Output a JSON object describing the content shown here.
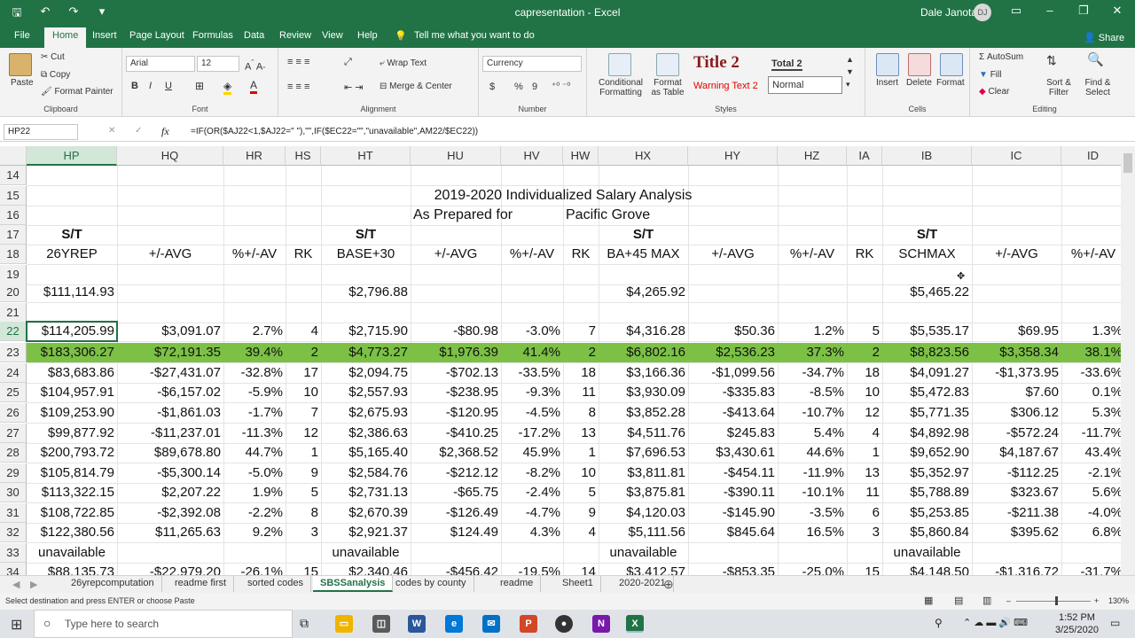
{
  "window": {
    "doc_title": "capresentation  -  Excel",
    "user": "Dale Janota",
    "user_initials": "DJ"
  },
  "qat": {
    "save": "🖫",
    "undo": "↶",
    "redo": "↷",
    "customize": "▾"
  },
  "tabs": [
    "File",
    "Home",
    "Insert",
    "Page Layout",
    "Formulas",
    "Data",
    "Review",
    "View",
    "Help"
  ],
  "tell_me": "Tell me what you want to do",
  "share": "Share",
  "ribbon": {
    "clipboard": {
      "paste": "Paste",
      "cut": "Cut",
      "copy": "Copy",
      "format_painter": "Format Painter",
      "label": "Clipboard"
    },
    "font": {
      "name": "Arial",
      "size": "12",
      "bold": "B",
      "italic": "I",
      "underline": "U",
      "label": "Font"
    },
    "alignment": {
      "wrap": "Wrap Text",
      "merge": "Merge & Center",
      "label": "Alignment"
    },
    "number": {
      "format": "Currency",
      "dollar": "$",
      "percent": "%",
      "comma": "9",
      "label": "Number"
    },
    "styles": {
      "conditional": "Conditional Formatting",
      "format_table": "Format as Table",
      "title2": "Title 2",
      "total2": "Total 2",
      "warning": "Warning Text 2",
      "normal": "Normal",
      "label": "Styles"
    },
    "cells": {
      "insert": "Insert",
      "delete": "Delete",
      "format": "Format",
      "label": "Cells"
    },
    "editing": {
      "autosum": "AutoSum",
      "fill": "Fill",
      "clear": "Clear",
      "sort": "Sort & Filter",
      "find": "Find & Select",
      "label": "Editing"
    }
  },
  "formula_bar": {
    "name_box": "HP22",
    "fx": "fx",
    "formula": "=IF(OR($AJ22<1,$AJ22=\" \"),\"\",IF($EC22=\"\",\"unavailable\",AM22/$EC22))"
  },
  "columns": [
    "HP",
    "HQ",
    "HR",
    "HS",
    "HT",
    "HU",
    "HV",
    "HW",
    "HX",
    "HY",
    "HZ",
    "IA",
    "IB",
    "IC",
    "ID"
  ],
  "row_numbers": [
    "14",
    "15",
    "16",
    "17",
    "18",
    "19",
    "20",
    "21",
    "22",
    "23",
    "24",
    "25",
    "26",
    "27",
    "28",
    "29",
    "30",
    "31",
    "32",
    "33",
    "34"
  ],
  "title_line1": "2019-2020 Individualized Salary  Analysis",
  "title_line2a": "As Prepared for",
  "title_line2b": "Pacific Grove",
  "st_label": "S/T",
  "headers": [
    "26YREP",
    "+/-AVG",
    "%+/-AV",
    "RK",
    "BASE+30",
    "+/-AVG",
    "%+/-AV",
    "RK",
    "BA+45 MAX",
    "+/-AVG",
    "%+/-AV",
    "RK",
    "SCHMAX",
    "+/-AVG",
    "%+/-AV"
  ],
  "row20": {
    "hp": "$111,114.93",
    "ht": "$2,796.88",
    "hx": "$4,265.92",
    "ib": "$5,465.22"
  },
  "rows": [
    [
      "$114,205.99",
      "$3,091.07",
      "2.7%",
      "4",
      "$2,715.90",
      "-$80.98",
      "-3.0%",
      "7",
      "$4,316.28",
      "$50.36",
      "1.2%",
      "5",
      "$5,535.17",
      "$69.95",
      "1.3%"
    ],
    [
      "$183,306.27",
      "$72,191.35",
      "39.4%",
      "2",
      "$4,773.27",
      "$1,976.39",
      "41.4%",
      "2",
      "$6,802.16",
      "$2,536.23",
      "37.3%",
      "2",
      "$8,823.56",
      "$3,358.34",
      "38.1%"
    ],
    [
      "$83,683.86",
      "-$27,431.07",
      "-32.8%",
      "17",
      "$2,094.75",
      "-$702.13",
      "-33.5%",
      "18",
      "$3,166.36",
      "-$1,099.56",
      "-34.7%",
      "18",
      "$4,091.27",
      "-$1,373.95",
      "-33.6%"
    ],
    [
      "$104,957.91",
      "-$6,157.02",
      "-5.9%",
      "10",
      "$2,557.93",
      "-$238.95",
      "-9.3%",
      "11",
      "$3,930.09",
      "-$335.83",
      "-8.5%",
      "10",
      "$5,472.83",
      "$7.60",
      "0.1%"
    ],
    [
      "$109,253.90",
      "-$1,861.03",
      "-1.7%",
      "7",
      "$2,675.93",
      "-$120.95",
      "-4.5%",
      "8",
      "$3,852.28",
      "-$413.64",
      "-10.7%",
      "12",
      "$5,771.35",
      "$306.12",
      "5.3%"
    ],
    [
      "$99,877.92",
      "-$11,237.01",
      "-11.3%",
      "12",
      "$2,386.63",
      "-$410.25",
      "-17.2%",
      "13",
      "$4,511.76",
      "$245.83",
      "5.4%",
      "4",
      "$4,892.98",
      "-$572.24",
      "-11.7%"
    ],
    [
      "$200,793.72",
      "$89,678.80",
      "44.7%",
      "1",
      "$5,165.40",
      "$2,368.52",
      "45.9%",
      "1",
      "$7,696.53",
      "$3,430.61",
      "44.6%",
      "1",
      "$9,652.90",
      "$4,187.67",
      "43.4%"
    ],
    [
      "$105,814.79",
      "-$5,300.14",
      "-5.0%",
      "9",
      "$2,584.76",
      "-$212.12",
      "-8.2%",
      "10",
      "$3,811.81",
      "-$454.11",
      "-11.9%",
      "13",
      "$5,352.97",
      "-$112.25",
      "-2.1%"
    ],
    [
      "$113,322.15",
      "$2,207.22",
      "1.9%",
      "5",
      "$2,731.13",
      "-$65.75",
      "-2.4%",
      "5",
      "$3,875.81",
      "-$390.11",
      "-10.1%",
      "11",
      "$5,788.89",
      "$323.67",
      "5.6%"
    ],
    [
      "$108,722.85",
      "-$2,392.08",
      "-2.2%",
      "8",
      "$2,670.39",
      "-$126.49",
      "-4.7%",
      "9",
      "$4,120.03",
      "-$145.90",
      "-3.5%",
      "6",
      "$5,253.85",
      "-$211.38",
      "-4.0%"
    ],
    [
      "$122,380.56",
      "$11,265.63",
      "9.2%",
      "3",
      "$2,921.37",
      "$124.49",
      "4.3%",
      "4",
      "$5,111.56",
      "$845.64",
      "16.5%",
      "3",
      "$5,860.84",
      "$395.62",
      "6.8%"
    ]
  ],
  "unavailable": "unavailable",
  "row34": [
    "$88,135.73",
    "-$22,979.20",
    "-26.1%",
    "15",
    "$2,340.46",
    "-$456.42",
    "-19.5%",
    "14",
    "$3,412.57",
    "-$853.35",
    "-25.0%",
    "15",
    "$4,148.50",
    "-$1,316.72",
    "-31.7%"
  ],
  "sheets": [
    "26yrepcomputation",
    "readme first",
    "sorted codes",
    "SBSSanalysis",
    "codes by county",
    "readme",
    "Sheet1",
    "2020-2021"
  ],
  "active_sheet": "SBSSanalysis",
  "status": {
    "message": "Select destination and press ENTER or choose Paste",
    "zoom": "130%"
  },
  "taskbar": {
    "search": "Type here to search",
    "time": "1:52 PM",
    "date": "3/25/2020"
  },
  "colors": {
    "excel_green": "#217346",
    "highlight_row": "#7cc145"
  }
}
